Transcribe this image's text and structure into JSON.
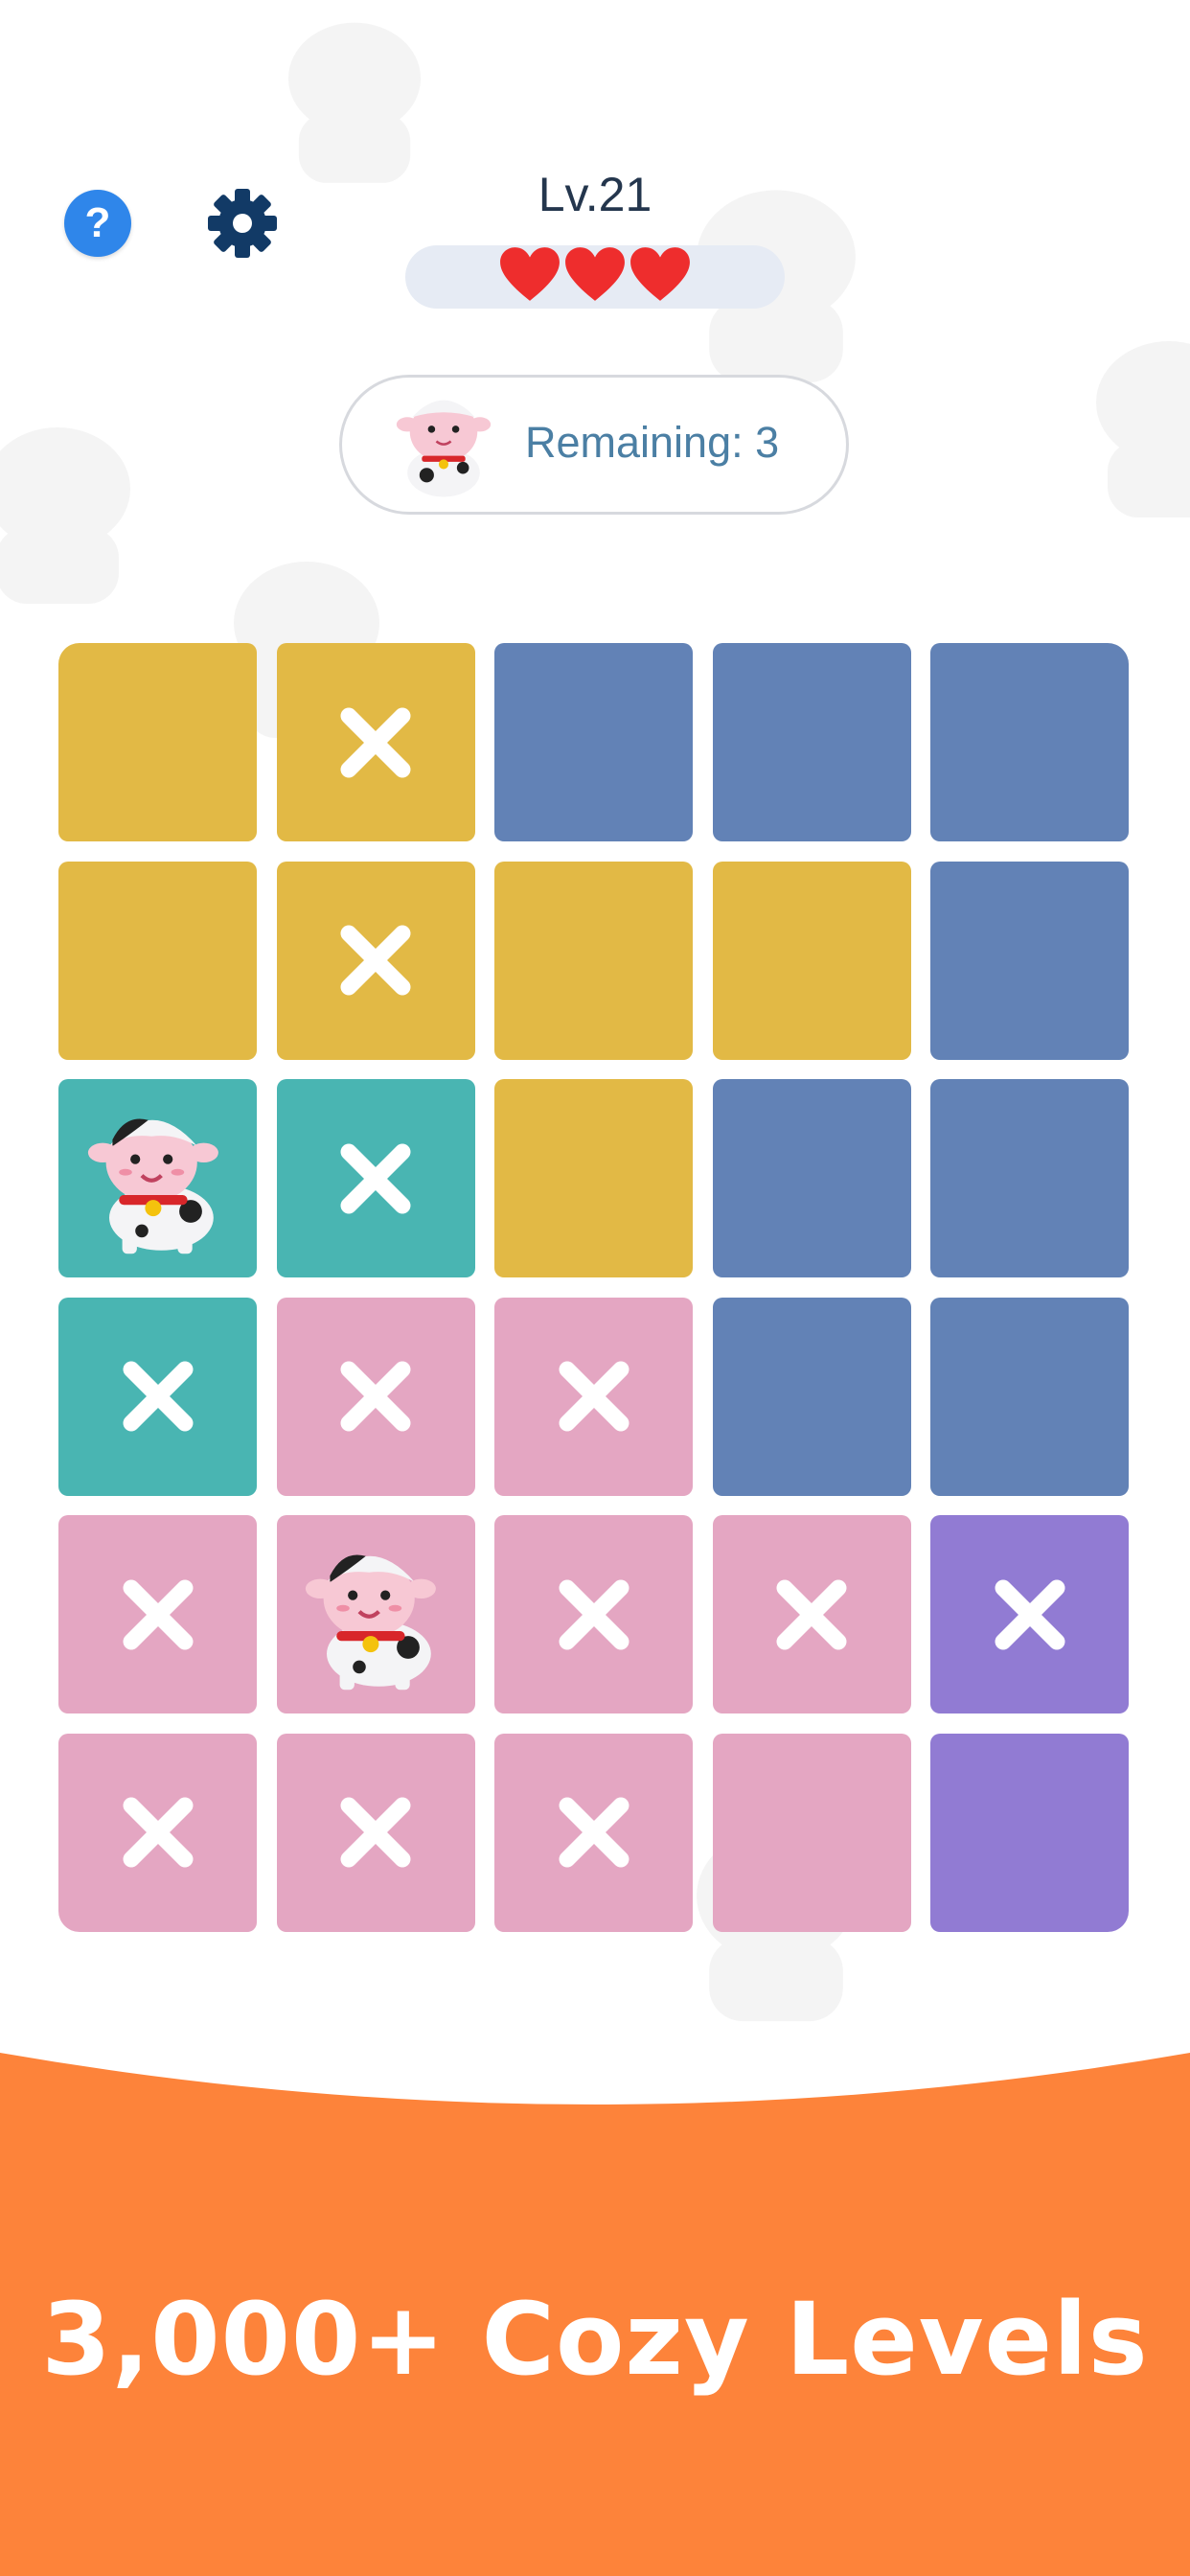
{
  "header": {
    "help_icon": "question-mark",
    "settings_icon": "gear",
    "level_label": "Lv.21",
    "lives": 3
  },
  "remaining": {
    "icon": "cow-icon",
    "text": "Remaining: 3"
  },
  "board": {
    "rows": 6,
    "cols": 5,
    "colors": {
      "yellow": "#e2b945",
      "blue": "#6282b6",
      "teal": "#49b5b2",
      "pink": "#e4a6c2",
      "purple": "#917bd3"
    },
    "cells": [
      [
        {
          "color": "yellow",
          "mark": ""
        },
        {
          "color": "yellow",
          "mark": "x"
        },
        {
          "color": "blue",
          "mark": ""
        },
        {
          "color": "blue",
          "mark": ""
        },
        {
          "color": "blue",
          "mark": ""
        }
      ],
      [
        {
          "color": "yellow",
          "mark": ""
        },
        {
          "color": "yellow",
          "mark": "x"
        },
        {
          "color": "yellow",
          "mark": ""
        },
        {
          "color": "yellow",
          "mark": ""
        },
        {
          "color": "blue",
          "mark": ""
        }
      ],
      [
        {
          "color": "teal",
          "mark": "cow"
        },
        {
          "color": "teal",
          "mark": "x"
        },
        {
          "color": "yellow",
          "mark": ""
        },
        {
          "color": "blue",
          "mark": ""
        },
        {
          "color": "blue",
          "mark": ""
        }
      ],
      [
        {
          "color": "teal",
          "mark": "x"
        },
        {
          "color": "pink",
          "mark": "x"
        },
        {
          "color": "pink",
          "mark": "x"
        },
        {
          "color": "blue",
          "mark": ""
        },
        {
          "color": "blue",
          "mark": ""
        }
      ],
      [
        {
          "color": "pink",
          "mark": "x"
        },
        {
          "color": "pink",
          "mark": "cow"
        },
        {
          "color": "pink",
          "mark": "x"
        },
        {
          "color": "pink",
          "mark": "x"
        },
        {
          "color": "purple",
          "mark": "x"
        }
      ],
      [
        {
          "color": "pink",
          "mark": "x"
        },
        {
          "color": "pink",
          "mark": "x"
        },
        {
          "color": "pink",
          "mark": "x"
        },
        {
          "color": "pink",
          "mark": ""
        },
        {
          "color": "purple",
          "mark": ""
        }
      ]
    ]
  },
  "banner": {
    "text": "3,000+ Cozy Levels",
    "color": "#fd833a"
  }
}
